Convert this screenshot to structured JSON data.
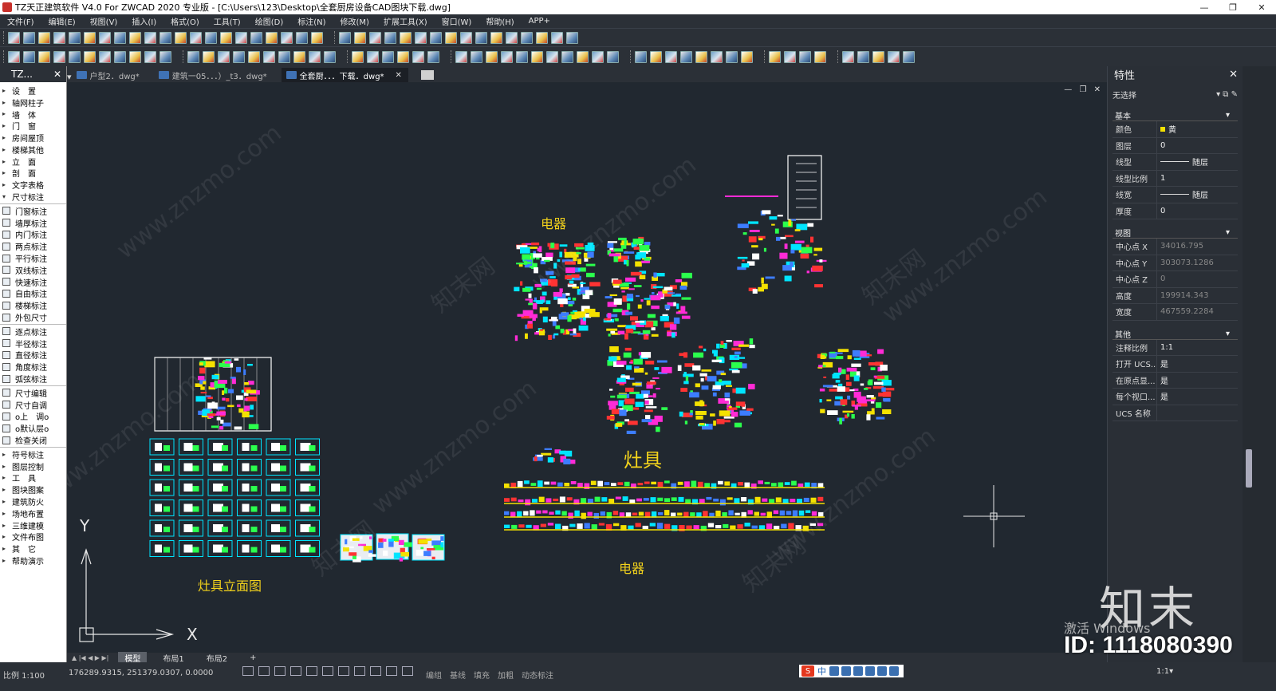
{
  "window": {
    "title": "TZ天正建筑软件 V4.0 For ZWCAD 2020 专业版 - [C:\\Users\\123\\Desktop\\全套厨房设备CAD图块下载.dwg]",
    "controls": [
      "—",
      "❐",
      "✕"
    ]
  },
  "menu": [
    "文件(F)",
    "编辑(E)",
    "视图(V)",
    "插入(I)",
    "格式(O)",
    "工具(T)",
    "绘图(D)",
    "标注(N)",
    "修改(M)",
    "扩展工具(X)",
    "窗口(W)",
    "帮助(H)",
    "APP+"
  ],
  "left_panel": {
    "title": "TZ...",
    "close": "✕",
    "groups": [
      {
        "type": "expand",
        "items": [
          "设　置",
          "轴网柱子",
          "墙　体",
          "门　窗",
          "房间屋顶",
          "楼梯其他",
          "立　面",
          "剖　面",
          "文字表格"
        ]
      },
      {
        "type": "open",
        "items": [
          "尺寸标注"
        ]
      },
      {
        "type": "sub",
        "items": [
          "门窗标注",
          "墙厚标注",
          "内门标注",
          "两点标注",
          "平行标注",
          "双线标注",
          "快速标注",
          "自由标注",
          "楼梯标注",
          "外包尺寸"
        ]
      },
      {
        "type": "sub",
        "items": [
          "逐点标注",
          "半径标注",
          "直径标注",
          "角度标注",
          "弧弦标注"
        ]
      },
      {
        "type": "sub",
        "items": [
          "尺寸编辑",
          "尺寸自调",
          "o上　调o",
          "o默认层o",
          "检查关闭"
        ]
      },
      {
        "type": "expand",
        "items": [
          "符号标注",
          "图层控制",
          "工　具",
          "图块图案",
          "建筑防火",
          "场地布置",
          "三维建模",
          "文件布图",
          "其　它",
          "帮助演示"
        ]
      }
    ]
  },
  "doc_tabs": [
    {
      "label": "户型2．dwg*",
      "active": false
    },
    {
      "label": "建筑一05．．．）_t3．dwg*",
      "active": false
    },
    {
      "label": "全套厨．．．下载．dwg*",
      "active": true
    }
  ],
  "canvas": {
    "labels": {
      "electric_top": "电器",
      "stove": "灶具",
      "stove_elevation": "灶具立面图",
      "electric_bottom": "电器"
    },
    "ucs": {
      "y": "Y",
      "x": "X"
    },
    "watermark": "www.znzmo.com",
    "watermark_cn": "知末网"
  },
  "layout_tabs": [
    "模型",
    "布局1",
    "布局2",
    "+"
  ],
  "properties": {
    "title": "特性",
    "close": "✕",
    "selection": "无选择",
    "sections": [
      {
        "name": "基本",
        "rows": [
          {
            "k": "颜色",
            "v": "黄",
            "kind": "color"
          },
          {
            "k": "图层",
            "v": "0"
          },
          {
            "k": "线型",
            "v": "随层",
            "kind": "line"
          },
          {
            "k": "线型比例",
            "v": "1"
          },
          {
            "k": "线宽",
            "v": "随层",
            "kind": "line"
          },
          {
            "k": "厚度",
            "v": "0"
          }
        ]
      },
      {
        "name": "视图",
        "rows": [
          {
            "k": "中心点 X",
            "v": "34016.795",
            "dim": true
          },
          {
            "k": "中心点 Y",
            "v": "303073.1286",
            "dim": true
          },
          {
            "k": "中心点 Z",
            "v": "0",
            "dim": true
          },
          {
            "k": "高度",
            "v": "199914.343",
            "dim": true
          },
          {
            "k": "宽度",
            "v": "467559.2284",
            "dim": true
          }
        ]
      },
      {
        "name": "其他",
        "rows": [
          {
            "k": "注释比例",
            "v": "1:1"
          },
          {
            "k": "打开 UCS...",
            "v": "是"
          },
          {
            "k": "在原点显...",
            "v": "是"
          },
          {
            "k": "每个视口...",
            "v": "是"
          },
          {
            "k": "UCS 名称",
            "v": ""
          }
        ]
      }
    ]
  },
  "status": {
    "scale": "比例 1:100",
    "coords": "176289.9315, 251379.0307, 0.0000",
    "modes": [
      "编组",
      "基线",
      "填充",
      "加粗",
      "动态标注"
    ],
    "ime": "中",
    "annotation_scale": "1:1▾"
  },
  "overlay": {
    "logo": "知末",
    "activate": "激活 Windows",
    "id": "ID: 1118080390"
  },
  "colors": {
    "cad_yellow": "#f2d21c",
    "canvas_bg": "#212830",
    "panel_bg": "#2b3037"
  }
}
